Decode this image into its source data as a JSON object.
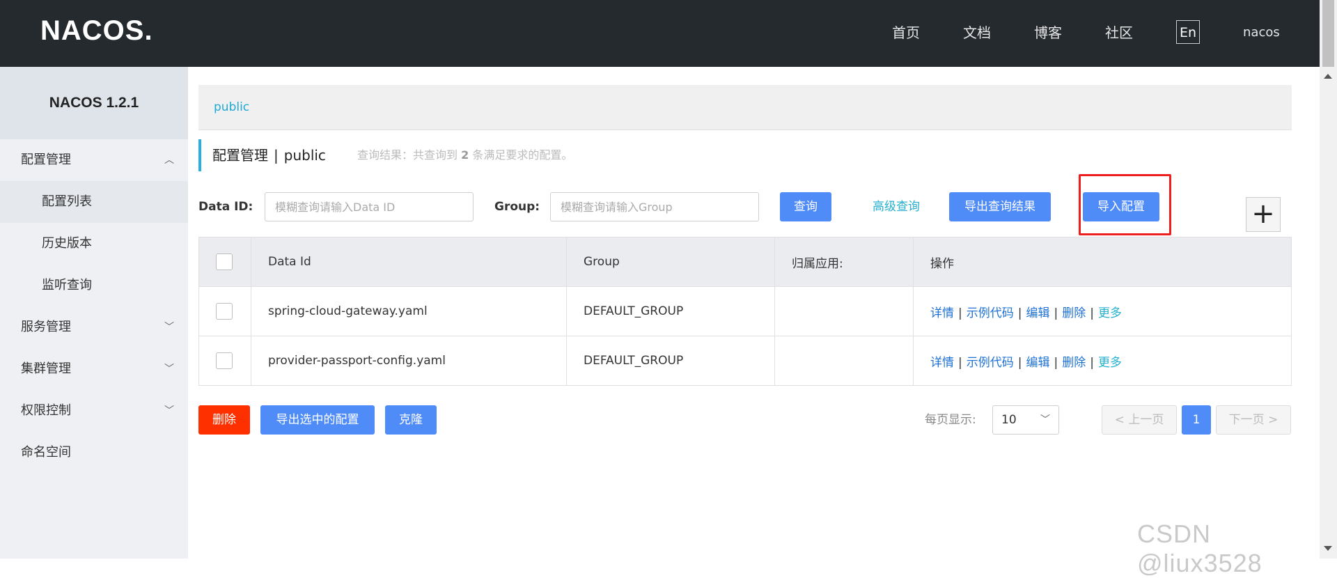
{
  "header": {
    "logo_text": "NACOS.",
    "nav": [
      "首页",
      "文档",
      "博客",
      "社区"
    ],
    "lang": "En",
    "user": "nacos"
  },
  "sidebar": {
    "title": "NACOS 1.2.1",
    "groups": [
      {
        "label": "配置管理",
        "expanded": true,
        "items": [
          "配置列表",
          "历史版本",
          "监听查询"
        ]
      },
      {
        "label": "服务管理",
        "expanded": false
      },
      {
        "label": "集群管理",
        "expanded": false
      },
      {
        "label": "权限控制",
        "expanded": false
      },
      {
        "label": "命名空间"
      }
    ]
  },
  "namespace_tab": "public",
  "page_header": {
    "title": "配置管理",
    "sep": "|",
    "namespace": "public",
    "result_prefix": "查询结果：共查询到",
    "result_count": "2",
    "result_suffix": "条满足要求的配置。"
  },
  "filters": {
    "dataid_label": "Data ID:",
    "dataid_placeholder": "模糊查询请输入Data ID",
    "group_label": "Group:",
    "group_placeholder": "模糊查询请输入Group",
    "query_btn": "查询",
    "advanced_btn": "高级查询",
    "export_result_btn": "导出查询结果",
    "import_btn": "导入配置",
    "add_btn": "+"
  },
  "table": {
    "columns": [
      "Data Id",
      "Group",
      "归属应用:",
      "操作"
    ],
    "rows": [
      {
        "data_id": "spring-cloud-gateway.yaml",
        "group": "DEFAULT_GROUP",
        "app": ""
      },
      {
        "data_id": "provider-passport-config.yaml",
        "group": "DEFAULT_GROUP",
        "app": ""
      }
    ],
    "ops": [
      "详情",
      "示例代码",
      "编辑",
      "删除",
      "更多"
    ],
    "op_sep": "|"
  },
  "footer": {
    "delete_btn": "删除",
    "export_selected_btn": "导出选中的配置",
    "clone_btn": "克隆",
    "page_size_label": "每页显示:",
    "page_size": "10",
    "prev": "上一页",
    "current_page": "1",
    "next": "下一页"
  },
  "watermark": "CSDN @liux3528",
  "colors": {
    "primary": "#4f8cf7",
    "danger": "#ff3000",
    "highlight": "#ee1e1e",
    "link": "#25b0cf"
  }
}
